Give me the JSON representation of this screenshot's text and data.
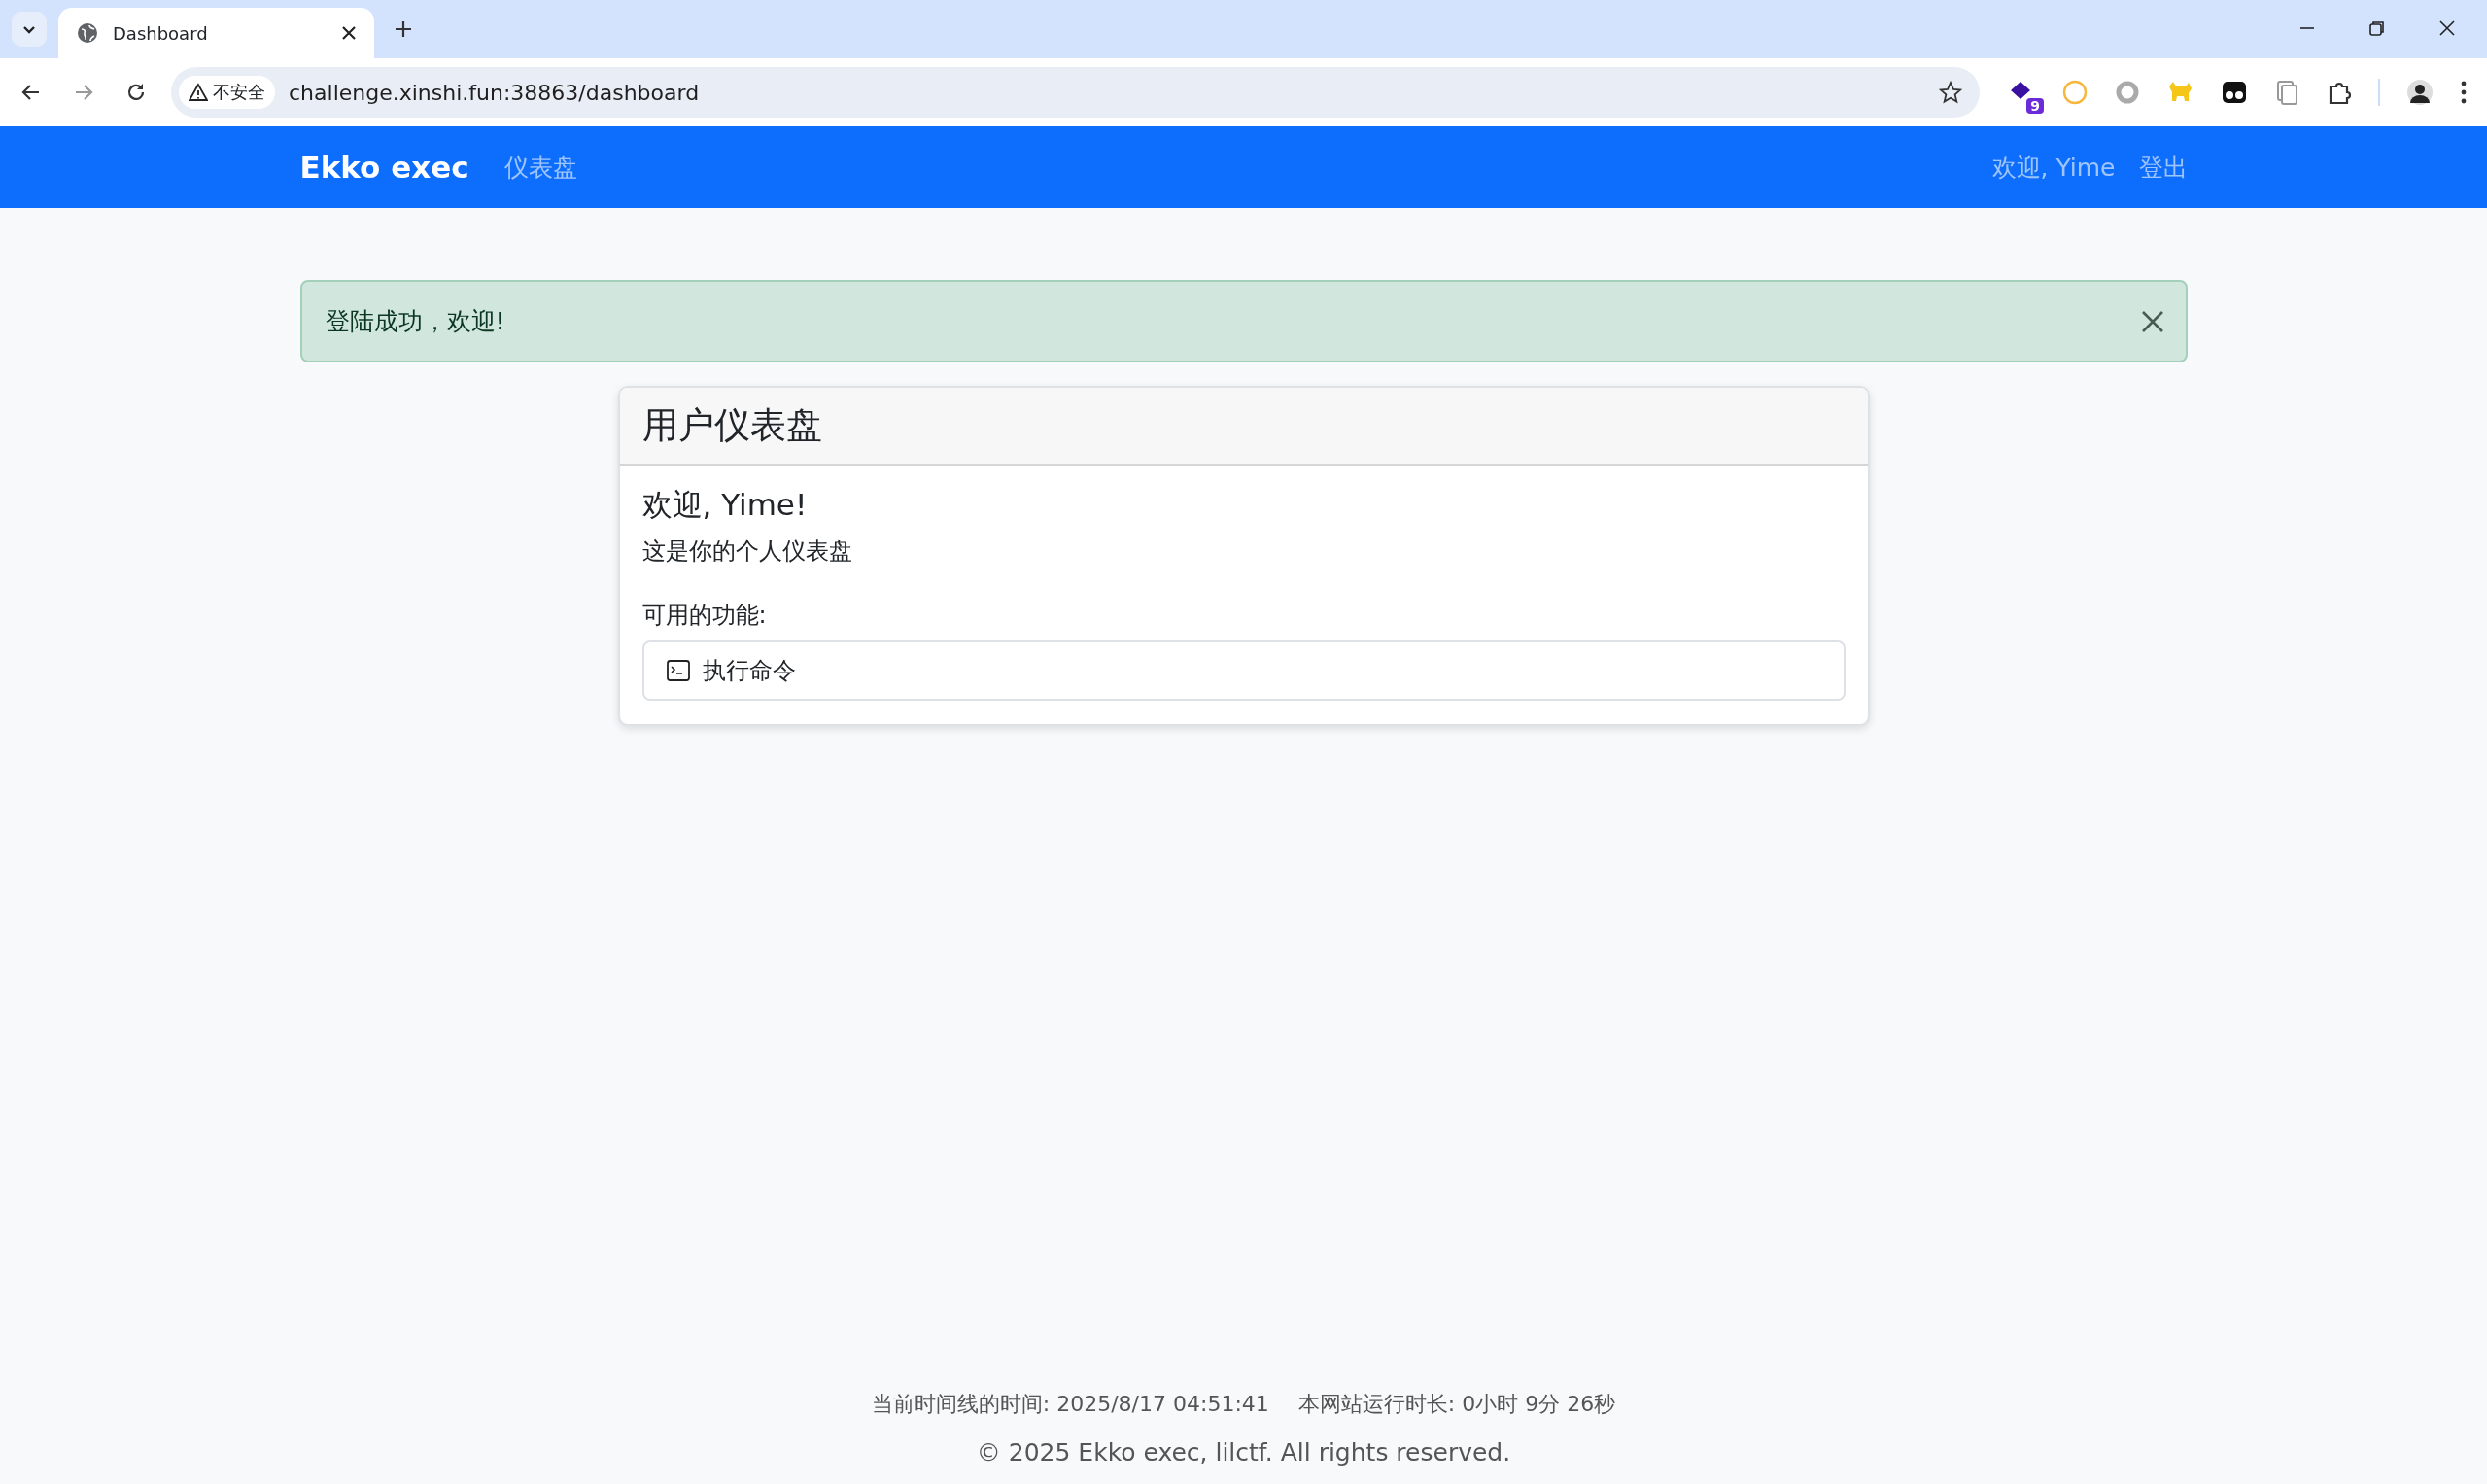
{
  "browser": {
    "tab_title": "Dashboard",
    "security_label": "不安全",
    "url": "challenge.xinshi.fun:38863/dashboard",
    "extension_badge": "9"
  },
  "navbar": {
    "brand": "Ekko exec",
    "links": [
      {
        "label": "仪表盘"
      }
    ],
    "user_links": [
      {
        "label": "欢迎, Yime"
      },
      {
        "label": "登出"
      }
    ]
  },
  "alert": {
    "message": "登陆成功，欢迎!"
  },
  "card": {
    "title": "用户仪表盘",
    "greeting": "欢迎, Yime!",
    "subtitle": "这是你的个人仪表盘",
    "features_label": "可用的功能:",
    "features": [
      {
        "label": "执行命令"
      }
    ]
  },
  "footer": {
    "time": "当前时间线的时间: 2025/8/17 04:51:41",
    "uptime": "本网站运行时长: 0小时 9分 26秒",
    "copyright": "© 2025 Ekko exec, lilctf. All rights reserved."
  }
}
